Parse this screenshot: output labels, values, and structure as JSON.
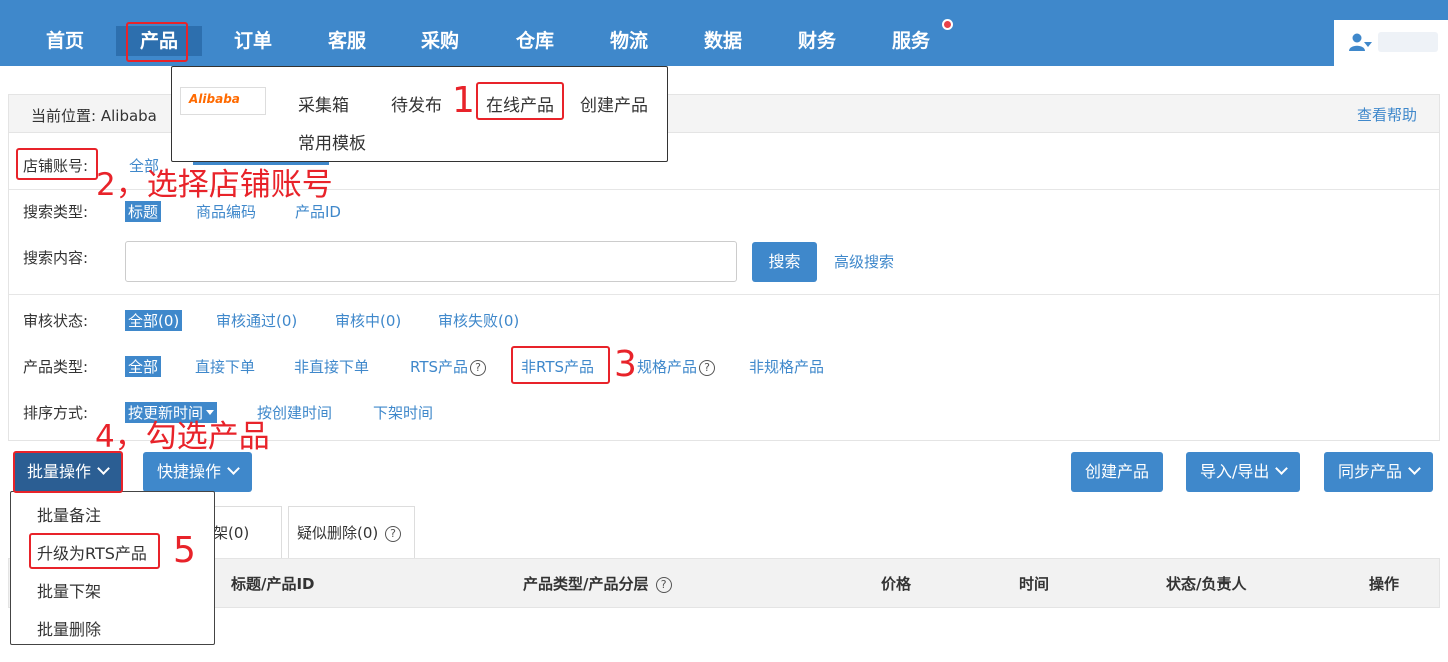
{
  "nav": {
    "items": [
      "首页",
      "产品",
      "订单",
      "客服",
      "采购",
      "仓库",
      "物流",
      "数据",
      "财务",
      "服务"
    ]
  },
  "breadcrumb": {
    "label": "当前位置:",
    "current": "Alibaba",
    "help": "查看帮助"
  },
  "product_menu": {
    "logo": "Alibaba",
    "items": [
      "采集箱",
      "待发布",
      "在线产品",
      "创建产品",
      "常用模板"
    ]
  },
  "filters": {
    "store": {
      "label": "店铺账号:",
      "all": "全部"
    },
    "search_type": {
      "label": "搜索类型:",
      "options": [
        "标题",
        "商品编码",
        "产品ID"
      ]
    },
    "search_content": {
      "label": "搜索内容:",
      "value": "",
      "button": "搜索",
      "advanced": "高级搜索"
    },
    "review_status": {
      "label": "审核状态:",
      "options": [
        "全部(0)",
        "审核通过(0)",
        "审核中(0)",
        "审核失败(0)"
      ]
    },
    "product_type": {
      "label": "产品类型:",
      "options": [
        "全部",
        "直接下单",
        "非直接下单",
        "RTS产品",
        "非RTS产品",
        "规格产品",
        "非规格产品"
      ]
    },
    "sort": {
      "label": "排序方式:",
      "options": [
        "按更新时间",
        "按创建时间",
        "下架时间"
      ]
    }
  },
  "actions": {
    "batch": "批量操作",
    "quick": "快捷操作",
    "create": "创建产品",
    "import_export": "导入/导出",
    "sync": "同步产品"
  },
  "batch_menu": {
    "items": [
      "批量备注",
      "升级为RTS产品",
      "批量下架",
      "批量删除"
    ]
  },
  "tabs": [
    "架(0)",
    "疑似删除(0)"
  ],
  "table": {
    "headers": [
      "标题/产品ID",
      "产品类型/产品分层",
      "价格",
      "时间",
      "状态/负责人",
      "操作"
    ]
  },
  "annotations": {
    "a1": "1",
    "a2": "2，选择店铺账号",
    "a3": "3",
    "a4": "4，勾选产品",
    "a5": "5"
  },
  "colors": {
    "nav_bg": "#3f88cb",
    "accent": "#3f88cb",
    "annotation": "#e8232a"
  }
}
